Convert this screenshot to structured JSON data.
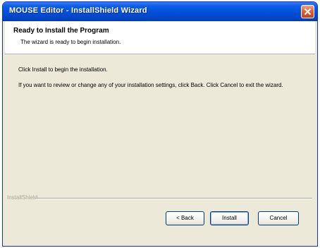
{
  "window": {
    "title": "MOUSE Editor - InstallShield Wizard"
  },
  "header": {
    "title": "Ready to Install the Program",
    "subtitle": "The wizard is ready to begin installation."
  },
  "content": {
    "line1": "Click Install to begin the installation.",
    "line2": "If you want to review or change any of your installation settings, click Back. Click Cancel to exit the wizard."
  },
  "footer": {
    "brand": "InstallShield",
    "back_label": "< Back",
    "install_label": "Install",
    "cancel_label": "Cancel"
  },
  "colors": {
    "titlebar": "#0351dd",
    "close_button": "#e0623a",
    "dialog_background": "#ece9d8"
  },
  "icons": {
    "close": "close-icon"
  }
}
